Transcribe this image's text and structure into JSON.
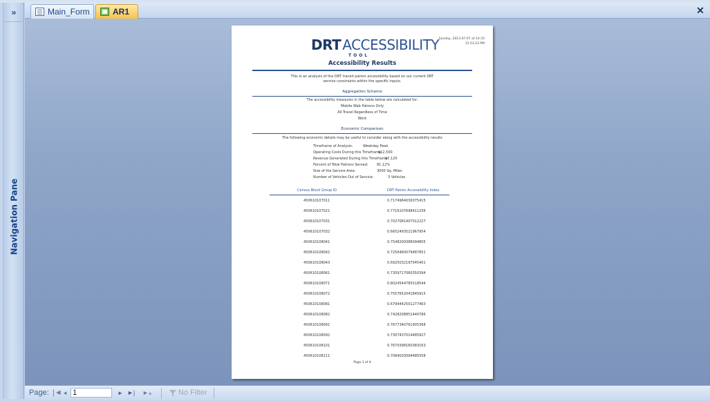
{
  "nav_pane": {
    "toggle": "»",
    "label": "Navigation Pane"
  },
  "tabs": [
    {
      "label": "Main_Form",
      "icon": "form-icon"
    },
    {
      "label": "AR1",
      "icon": "report-icon",
      "active": true
    }
  ],
  "close_label": "✕",
  "report": {
    "logo_drt": "DRT",
    "logo_accessibility": "ACCESSIBILITY",
    "logo_tool": "TOOL",
    "stamp_line1": "Sunday, 2013-07-07 at 14:33",
    "stamp_line2": "12:53:23 PM",
    "title": "Accessibility Results",
    "intro_line1": "This is an analysis of the DRT transit patron accessibility based on our current DRT",
    "intro_line2": "service constraints within the specific inputs.",
    "aggregation": {
      "heading": "Aggregation Scheme",
      "line1": "The accessibility measures in the table below are calculated for:",
      "line2": "Mobile Web Patrons Only",
      "line3": "All Travel Regardless of Time",
      "line4": "Work"
    },
    "economic": {
      "heading": "Economic Comparison",
      "intro": "The following economic details may be useful to consider along with the accessibility results",
      "rows": [
        {
          "label": "Timeframe of Analysis:",
          "value": "Weekday Peak"
        },
        {
          "label": "Operating Costs During this Timeframe:",
          "value": "$12,500"
        },
        {
          "label": "Revenue Generated During this Timeframe:",
          "value": "$7,120"
        },
        {
          "label": "Percent of Total Patrons Served:",
          "value": "81.12%"
        },
        {
          "label": "Size of the Service Area:",
          "value": "3000 Sq. Miles"
        },
        {
          "label": "Number of Vehicles Out of Service:",
          "value": "3 Vehicles"
        }
      ]
    },
    "table": {
      "col1": "Census Block Group ID",
      "col2": "DRT Patron Accessibility Index",
      "rows": [
        {
          "id": "450610107011",
          "index": "0.7174964030075415"
        },
        {
          "id": "450610107021",
          "index": "0.7716107698411256"
        },
        {
          "id": "450610107031",
          "index": "0.7027081407012227"
        },
        {
          "id": "450610107032",
          "index": "0.6652493521967954"
        },
        {
          "id": "450610108041",
          "index": "0.7548209388094805"
        },
        {
          "id": "450610108042",
          "index": "0.7256460079487851"
        },
        {
          "id": "450610108043",
          "index": "0.6925032197045401"
        },
        {
          "id": "450610108061",
          "index": "0.7359717060350394"
        },
        {
          "id": "450610108071",
          "index": "0.8024544785518544"
        },
        {
          "id": "450610108072",
          "index": "0.7557652041845915"
        },
        {
          "id": "450610108081",
          "index": "0.6794442501277463"
        },
        {
          "id": "450610108082",
          "index": "0.7428208851440786"
        },
        {
          "id": "450610108091",
          "index": "0.7677340761905368"
        },
        {
          "id": "450610108092",
          "index": "0.7307437014485927"
        },
        {
          "id": "450610108101",
          "index": "0.7670398160383163"
        },
        {
          "id": "450610108111",
          "index": "0.7084020094485558"
        }
      ]
    },
    "footer": "Page 1 of 4"
  },
  "record_nav": {
    "page_label": "Page:",
    "first": "|◄",
    "prev": "◄",
    "page_value": "1",
    "next": "►",
    "last": "►|",
    "new": "►⁎",
    "no_filter": "No Filter"
  }
}
